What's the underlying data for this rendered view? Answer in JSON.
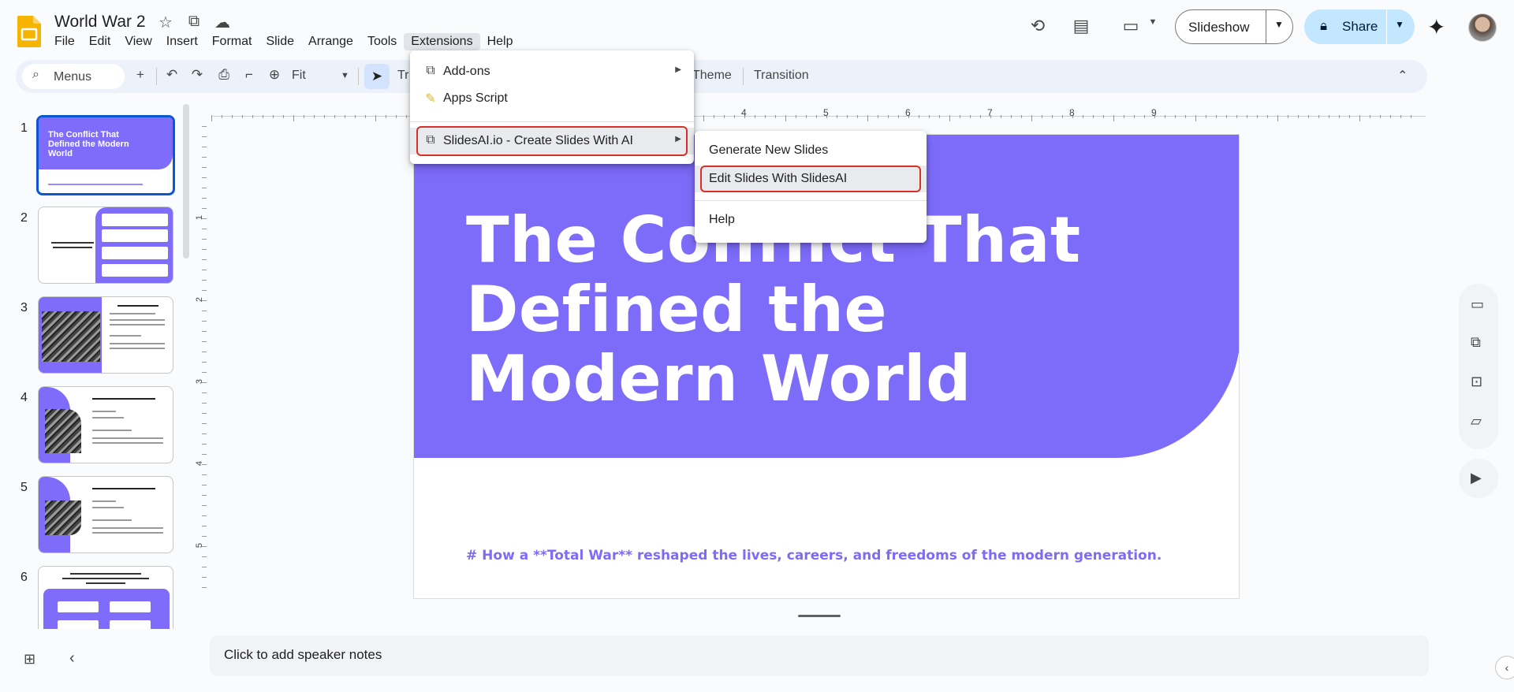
{
  "document": {
    "title": "World War 2"
  },
  "menubar": [
    "File",
    "Edit",
    "View",
    "Insert",
    "Format",
    "Slide",
    "Arrange",
    "Tools",
    "Extensions",
    "Help"
  ],
  "header": {
    "slideshow_label": "Slideshow",
    "share_label": "Share"
  },
  "toolbar": {
    "search_label": "Menus",
    "zoom_value": "Fit",
    "theme_label": "Theme",
    "transition_label": "Transition",
    "text_tool_partial": "Tr"
  },
  "filmstrip": {
    "slide_numbers": [
      "1",
      "2",
      "3",
      "4",
      "5",
      "6"
    ],
    "slide1_title": "The Conflict That Defined the Modern World"
  },
  "slide": {
    "title": "The Conflict That Defined the Modern World",
    "subtitle": "# How a **Total War** reshaped the lives, careers, and freedoms of the modern generation."
  },
  "ruler": {
    "horizontal": [
      "4",
      "5",
      "6",
      "7",
      "8",
      "9"
    ],
    "vertical": [
      "1",
      "2",
      "3",
      "4",
      "5"
    ]
  },
  "notes": {
    "placeholder": "Click to add speaker notes"
  },
  "extensions_menu": {
    "items": [
      "Add-ons",
      "Apps Script",
      "SlidesAI.io - Create Slides With AI"
    ]
  },
  "slidesai_submenu": {
    "items": [
      "Generate New Slides",
      "Edit Slides With SlidesAI",
      "Help"
    ]
  },
  "colors": {
    "accent": "#7d6bfa",
    "share_bg": "#c2e7ff",
    "highlight_box": "#d93025"
  }
}
